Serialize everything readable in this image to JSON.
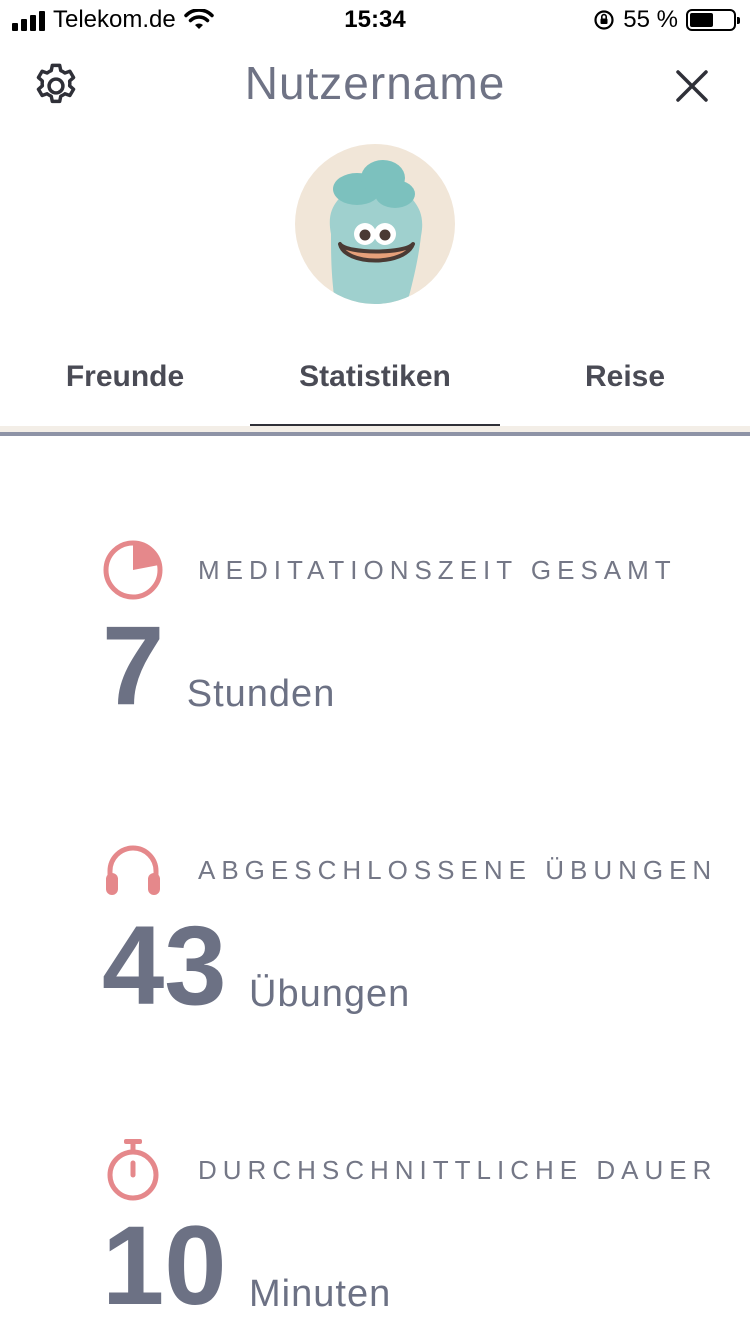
{
  "status_bar": {
    "carrier": "Telekom.de",
    "time": "15:34",
    "battery": "55 %",
    "battery_level": 0.55,
    "icons": [
      "signal-icon",
      "wifi-icon",
      "rotation-lock-icon",
      "battery-icon"
    ]
  },
  "header": {
    "title": "Nutzername",
    "settings_icon": "gear-icon",
    "close_icon": "close-icon"
  },
  "avatar": {
    "icon": "avatar-character"
  },
  "tabs": [
    {
      "label": "Freunde",
      "active": false
    },
    {
      "label": "Statistiken",
      "active": true
    },
    {
      "label": "Reise",
      "active": false
    }
  ],
  "stats": [
    {
      "icon": "pie-clock-icon",
      "label": "MEDITATIONSZEIT GESAMT",
      "value": "7",
      "unit": "Stunden"
    },
    {
      "icon": "headphones-icon",
      "label": "ABGESCHLOSSENE ÜBUNGEN",
      "value": "43",
      "unit": "Übungen"
    },
    {
      "icon": "stopwatch-icon",
      "label": "DURCHSCHNITTLICHE DAUER",
      "value": "10",
      "unit": "Minuten"
    }
  ],
  "colors": {
    "accent": "#e5888b",
    "title": "#6f7385",
    "value": "#6c7184",
    "tab_underline": "#2f3038"
  }
}
